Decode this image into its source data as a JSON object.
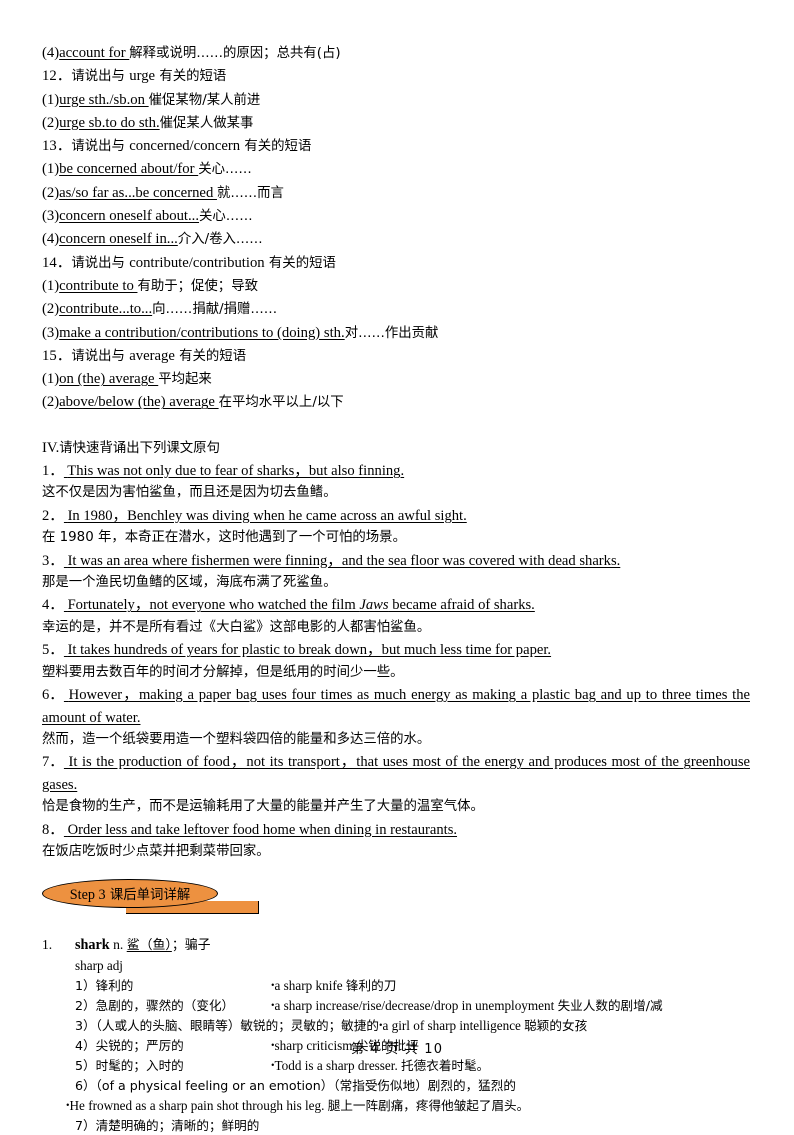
{
  "phrase_section": {
    "lead_item": {
      "marker": "(4)",
      "en": "account for ",
      "zh": "解释或说明……的原因；总共有(占)"
    },
    "groups": [
      {
        "number": "12．",
        "heading_zh_pre": "请说出与 ",
        "heading_en": "urge",
        "heading_zh_post": " 有关的短语",
        "items": [
          {
            "marker": "(1)",
            "en": "urge sth./sb.on ",
            "zh": "催促某物/某人前进"
          },
          {
            "marker": "(2)",
            "en": "urge sb.to do sth.",
            "zh": "催促某人做某事"
          }
        ]
      },
      {
        "number": "13．",
        "heading_zh_pre": "请说出与 ",
        "heading_en": "concerned/concern",
        "heading_zh_post": " 有关的短语",
        "items": [
          {
            "marker": "(1)",
            "en": "be concerned about/for ",
            "zh": " 关心……"
          },
          {
            "marker": "(2)",
            "en": "as/so far as...be concerned ",
            "zh": "就……而言"
          },
          {
            "marker": "(3)",
            "en": "concern oneself about...",
            "zh": "关心……"
          },
          {
            "marker": "(4)",
            "en": "concern oneself in...",
            "zh": "介入/卷入……"
          }
        ]
      },
      {
        "number": "14．",
        "heading_zh_pre": "请说出与 ",
        "heading_en": "contribute/contribution",
        "heading_zh_post": " 有关的短语",
        "items": [
          {
            "marker": "(1)",
            "en": "contribute to ",
            "zh": "有助于；促使；导致"
          },
          {
            "marker": "(2)",
            "en": "contribute...to...",
            "zh": "向……捐献/捐赠……"
          },
          {
            "marker": "(3)",
            "en": "make a contribution/contributions to (doing) sth.",
            "zh": "对……作出贡献"
          }
        ]
      },
      {
        "number": "15．",
        "heading_zh_pre": "请说出与 ",
        "heading_en": "average",
        "heading_zh_post": " 有关的短语",
        "items": [
          {
            "marker": "(1)",
            "en": "on (the) average ",
            "zh": "平均起来"
          },
          {
            "marker": "(2)",
            "en": "above/below (the) average ",
            "zh": "在平均水平以上/以下"
          }
        ]
      }
    ]
  },
  "recite_section": {
    "heading_num": "IV.",
    "heading_zh": "请快速背诵出下列课文原句",
    "sentences": [
      {
        "index": "1．",
        "en": "This was not only due to fear of sharks，but also finning.",
        "zh": "这不仅是因为害怕鲨鱼，而且还是因为切去鱼鳍。",
        "wrap": false
      },
      {
        "index": "2．",
        "en": "In 1980，Benchley was diving when he came across an awful sight.",
        "zh": "在 1980 年，本奇正在潜水，这时他遇到了一个可怕的场景。",
        "wrap": false
      },
      {
        "index": "3．",
        "en": "It was an area where fishermen were finning，and the sea floor was covered with dead sharks.",
        "zh": "那是一个渔民切鱼鳍的区域，海底布满了死鲨鱼。",
        "wrap": false
      },
      {
        "index": "4．",
        "en_pre": "Fortunately，not everyone who watched the film ",
        "en_italic": "Jaws",
        "en_post": " became afraid of sharks.",
        "zh": "幸运的是，并不是所有看过《大白鲨》这部电影的人都害怕鲨鱼。",
        "wrap": false,
        "has_italic": true
      },
      {
        "index": "5．",
        "en": "It takes hundreds of years for plastic to break down，but much less time for paper.",
        "zh": "塑料要用去数百年的时间才分解掉，但是纸用的时间少一些。",
        "wrap": false
      },
      {
        "index": "6．",
        "en": "However，making a paper bag uses four times as much energy as making a plastic bag and up to three times the amount of water.",
        "zh": "然而，造一个纸袋要用造一个塑料袋四倍的能量和多达三倍的水。",
        "wrap": true
      },
      {
        "index": "7．",
        "en": "It is the production of food，not its transport，that uses most of the energy and produces most of the greenhouse gases.",
        "zh": "恰是食物的生产，而不是运输耗用了大量的能量并产生了大量的温室气体。",
        "wrap": true
      },
      {
        "index": "8．",
        "en": "Order less and take leftover food home when dining in restaurants.",
        "zh": "在饭店吃饭时少点菜并把剩菜带回家。",
        "wrap": false
      }
    ]
  },
  "step_banner": {
    "step_label": "Step 3",
    "title_zh": "课后单词详解",
    "color": "#ED9140"
  },
  "vocabulary": [
    {
      "number": "1.",
      "word": "shark",
      "pos": "n.",
      "gloss_underlined": "鲨（鱼）",
      "gloss_rest": "；骗子",
      "sub_entry": "sharp adj",
      "senses": [
        {
          "marker": "1）",
          "def": "锋利的",
          "example_en": "a sharp knife ",
          "example_zh": "锋利的刀",
          "layout": "two-col"
        },
        {
          "marker": "2）",
          "def": "急剧的，骤然的（变化）",
          "example_en": "a sharp increase/rise/decrease/drop in unemployment ",
          "example_zh": "失业人数的剧增/减",
          "layout": "two-col"
        },
        {
          "marker": "3）",
          "def": "（人或人的头脑、眼睛等）敏锐的；灵敏的；敏捷的",
          "example_en": "a girl of sharp intelligence ",
          "example_zh": "聪颖的女孩",
          "layout": "two-col-wide"
        },
        {
          "marker": "4）",
          "def": "尖锐的；严厉的",
          "example_en": "sharp criticism ",
          "example_zh": "尖锐的批评",
          "layout": "two-col"
        },
        {
          "marker": "5）",
          "def": "时髦的；入时的",
          "example_en": "Todd is a sharp dresser. ",
          "example_zh": "托德衣着时髦。",
          "layout": "two-col"
        },
        {
          "marker": "6）",
          "def_en": "（of a physical feeling or an emotion）",
          "def_zh": "（常指受伤似地）剧烈的，猛烈的",
          "example_en": "He frowned as a sharp pain shot through his leg. ",
          "example_zh": "腿上一阵剧痛，疼得他皱起了眉头。",
          "layout": "full-width"
        },
        {
          "marker": "7）",
          "def": "清楚明确的；清晰的；鲜明的",
          "layout": "def-only"
        }
      ]
    }
  ],
  "footer": {
    "text": "第 4 页 共 10"
  }
}
